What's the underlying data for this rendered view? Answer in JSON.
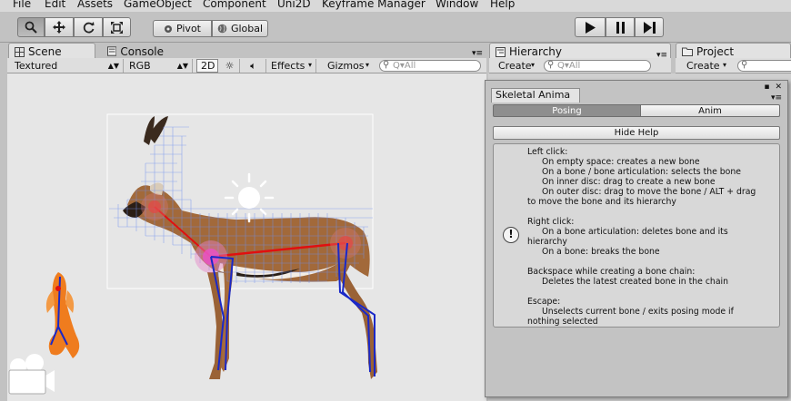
{
  "menu": [
    "File",
    "Edit",
    "Assets",
    "GameObject",
    "Component",
    "Uni2D",
    "Keyframe Manager",
    "Window",
    "Help"
  ],
  "toolbar": {
    "pivot": "Pivot",
    "global": "Global"
  },
  "tabs": {
    "scene": "Scene",
    "console": "Console",
    "hierarchy": "Hierarchy",
    "project": "Project"
  },
  "scene_bar": {
    "draw_mode": "Textured",
    "render_mode": "RGB",
    "mode_2d": "2D",
    "effects": "Effects",
    "gizmos": "Gizmos",
    "search_placeholder": "Q▾All"
  },
  "hierarchy_bar": {
    "create": "Create",
    "search_placeholder": "Q▾All"
  },
  "project_bar": {
    "create": "Create"
  },
  "skeletal": {
    "title": "Skeletal Anima",
    "tab_posing": "Posing",
    "tab_anim": "Anim",
    "hide_help": "Hide Help",
    "help": {
      "left_click": "Left click:",
      "lc1": "On empty space: creates a new bone",
      "lc2": "On a bone / bone articulation: selects the bone",
      "lc3": "On inner disc: drag to create a new bone",
      "lc4": "On outer disc: drag to move the bone / ALT + drag",
      "lc4b": "to move the bone and its hierarchy",
      "right_click": "Right click:",
      "rc1": "On a bone articulation: deletes bone and its",
      "rc1b": "hierarchy",
      "rc2": "On a bone: breaks the bone",
      "backspace": "Backspace while creating a bone chain:",
      "bs1": "Deletes the latest created bone in the chain",
      "escape": "Escape:",
      "es1": "Unselects current bone / exits posing mode if",
      "es1b": "nothing selected"
    }
  },
  "colors": {
    "bone_red": "#e01010",
    "bone_blue": "#1a28c8",
    "mesh_blue": "#6f8fef",
    "active_tab": "#9a9a9a"
  }
}
